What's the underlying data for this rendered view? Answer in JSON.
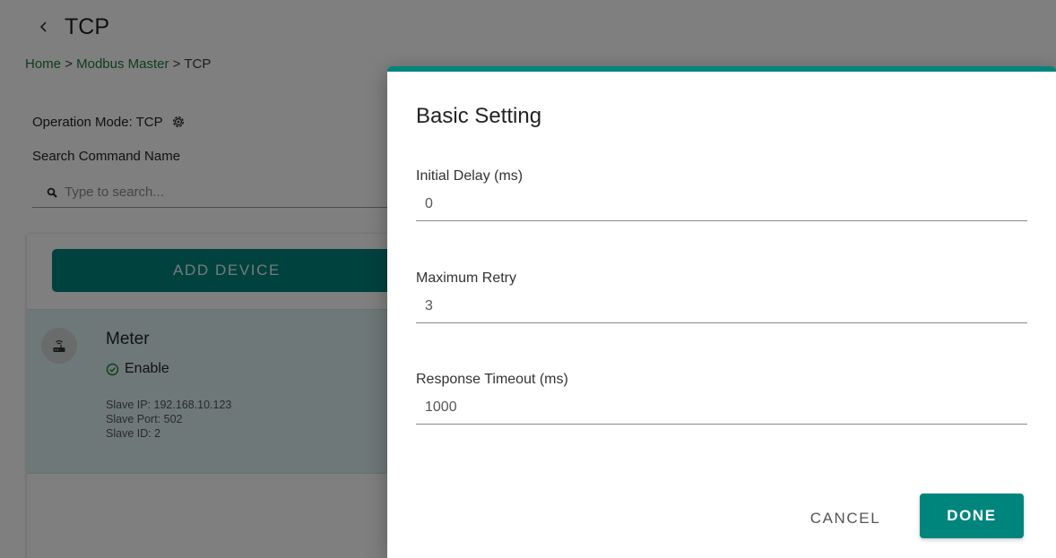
{
  "page": {
    "title": "TCP",
    "breadcrumb": {
      "home": "Home",
      "sep1": ">",
      "master": "Modbus Master",
      "sep2": ">",
      "current": "TCP"
    },
    "operation_mode": "Operation Mode: TCP",
    "search": {
      "label": "Search Command Name",
      "placeholder": "Type to search..."
    },
    "add_device_label": "ADD DEVICE",
    "device": {
      "name": "Meter",
      "status": "Enable",
      "slave_ip": "Slave IP: 192.168.10.123",
      "slave_port": "Slave Port: 502",
      "slave_id": "Slave ID: 2"
    }
  },
  "dialog": {
    "title": "Basic Setting",
    "fields": [
      {
        "label": "Initial Delay (ms)",
        "value": "0"
      },
      {
        "label": "Maximum Retry",
        "value": "3"
      },
      {
        "label": "Response Timeout (ms)",
        "value": "1000"
      }
    ],
    "cancel_label": "CANCEL",
    "done_label": "DONE"
  },
  "icons": {
    "back": "chevron-left-icon",
    "settings": "gear-icon",
    "search": "search-icon",
    "device": "router-icon",
    "status": "check-circle-icon"
  },
  "colors": {
    "primary": "#00857d",
    "link": "#1e7a38",
    "card_bg": "#dff1f0"
  }
}
